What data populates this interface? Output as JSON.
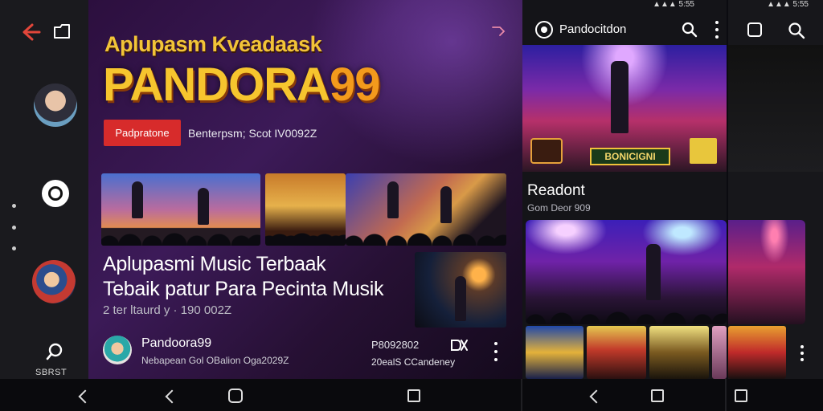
{
  "left_rail": {
    "search_label": "SBRST"
  },
  "main": {
    "hero_subtitle": "Aplupasm Kveadaask",
    "hero_title_text": "PANDORA",
    "hero_title_num": "99",
    "hero_button": "Padpratone",
    "hero_meta": "Benterpsm; Scot IV0092Z",
    "video_title_line1": "Aplupasmi Music Terbaak",
    "video_title_line2": "Tebaik patur Para Pecinta Musik",
    "video_stats": "2 ter ltaurd y · 190 002Z",
    "channel_name": "Pandoora99",
    "channel_desc": "Nebapean Gol OBalion Oga2029Z",
    "views_count": "P8092802",
    "views_label": "20ealS CCandeney"
  },
  "right": {
    "status_signal": "▲▲▲ 5:55",
    "appbar_title": "Pandocitdon",
    "hero_logo_text": "BONICIGNI",
    "section_title": "Readont",
    "section_sub": "Gom Deor 909"
  },
  "far": {
    "status_signal": "▲▲▲ 5:55"
  },
  "colors": {
    "accent_red": "#d72b2b",
    "brand_gold": "#f6c52e",
    "back_arrow": "#e2463a"
  }
}
